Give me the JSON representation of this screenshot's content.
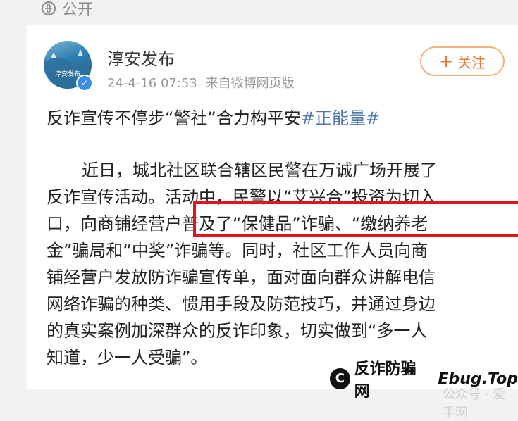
{
  "header": {
    "visibility_label": "公开"
  },
  "post": {
    "author": "淳安发布",
    "avatar_text": "淳安发布",
    "timestamp": "24-4-16 07:53",
    "source": "来自微博网页版",
    "follow_label": "关注",
    "headline_main": "反诈宣传不停步“警社”合力构平安",
    "headline_hashtag": "#正能量#",
    "body_lines": [
      "近日，城北社区联合辖区民警在万诚广场开展了",
      "反诈宣传活动。活动中，民警以“艾兴合”投资为切入",
      "口，向商铺经营户普及了“保健品”诈骗、“缴纳养老",
      "金”骗局和“中奖”诈骗等。同时，社区工作人员向商",
      "铺经营户发放防诈骗宣传单，面对面向群众讲解电信",
      "网络诈骗的种类、惯用手段及防范技巧，并通过身边",
      "的真实案例加深群众的反诈印象，切实做到“多一人",
      "知道，少一人受骗”。"
    ]
  },
  "watermark": {
    "text": "公众号 · 爱手网",
    "brand_logo": "C",
    "brand_name": "反诈防骗网",
    "brand_site": "Ebug.Top"
  },
  "colors": {
    "highlight": "#e3141b",
    "follow": "#e8762c",
    "hashtag": "#4f78a8"
  }
}
